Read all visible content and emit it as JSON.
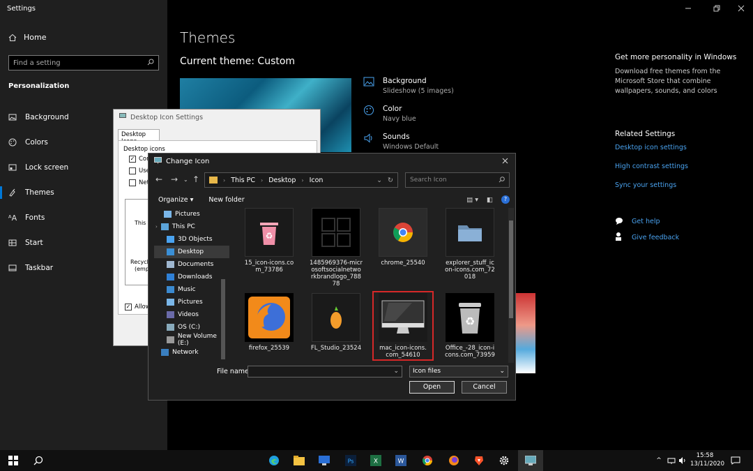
{
  "settings": {
    "window_title": "Settings",
    "home": "Home",
    "search_placeholder": "Find a setting",
    "section": "Personalization",
    "nav": [
      {
        "label": "Background",
        "icon": "picture-icon"
      },
      {
        "label": "Colors",
        "icon": "palette-icon"
      },
      {
        "label": "Lock screen",
        "icon": "lock-screen-icon"
      },
      {
        "label": "Themes",
        "icon": "themes-icon",
        "active": true
      },
      {
        "label": "Fonts",
        "icon": "fonts-icon"
      },
      {
        "label": "Start",
        "icon": "start-icon"
      },
      {
        "label": "Taskbar",
        "icon": "taskbar-icon"
      }
    ],
    "main_title": "Themes",
    "current_theme": "Current theme: Custom",
    "props": [
      {
        "title": "Background",
        "sub": "Slideshow (5 images)"
      },
      {
        "title": "Color",
        "sub": "Navy blue"
      },
      {
        "title": "Sounds",
        "sub": "Windows Default"
      }
    ],
    "right": {
      "personality_heading": "Get more personality in Windows",
      "personality_text": "Download free themes from the Microsoft Store that combine wallpapers, sounds, and colors",
      "related_heading": "Related Settings",
      "links": [
        "Desktop icon settings",
        "High contrast settings",
        "Sync your settings"
      ],
      "help": "Get help",
      "feedback": "Give feedback"
    }
  },
  "desktop_icon_settings": {
    "title": "Desktop Icon Settings",
    "tab": "Desktop Icons",
    "group": "Desktop icons",
    "checkboxes": [
      {
        "label": "Com",
        "checked": true
      },
      {
        "label": "User",
        "checked": false
      },
      {
        "label": "Netw",
        "checked": false
      }
    ],
    "icon_labels": [
      "This P",
      "Recycle",
      "(empt"
    ],
    "allow": "Allow t"
  },
  "change_icon": {
    "title": "Change Icon",
    "path": [
      "This PC",
      "Desktop",
      "Icon"
    ],
    "search_placeholder": "Search Icon",
    "organize": "Organize",
    "new_folder": "New folder",
    "tree": [
      {
        "label": "Pictures",
        "indent": 1
      },
      {
        "label": "This PC",
        "indent": 0
      },
      {
        "label": "3D Objects",
        "indent": 1
      },
      {
        "label": "Desktop",
        "indent": 1,
        "selected": true
      },
      {
        "label": "Documents",
        "indent": 1
      },
      {
        "label": "Downloads",
        "indent": 1
      },
      {
        "label": "Music",
        "indent": 1
      },
      {
        "label": "Pictures",
        "indent": 1
      },
      {
        "label": "Videos",
        "indent": 1
      },
      {
        "label": "OS (C:)",
        "indent": 1
      },
      {
        "label": "New Volume (E:)",
        "indent": 1
      },
      {
        "label": "Network",
        "indent": 0
      }
    ],
    "files": [
      {
        "name": "15_icon-icons.co m_73786",
        "kind": "recycle-pink-icon"
      },
      {
        "name": "1485969376-micr osoftsocialnetwo rkbrandlogo_788 78",
        "kind": "windows-logo-icon"
      },
      {
        "name": "chrome_25540",
        "kind": "chrome-icon"
      },
      {
        "name": "explorer_stuff_ic on-icons.com_72 018",
        "kind": "folder-icon"
      },
      {
        "name": "firefox_25539",
        "kind": "firefox-icon"
      },
      {
        "name": "FL_Studio_23524",
        "kind": "fl-studio-icon"
      },
      {
        "name": "mac_icon-icons. com_54610",
        "kind": "imac-icon",
        "selected": true
      },
      {
        "name": "Office_-28_icon-i cons.com_73959",
        "kind": "recycle-gray-icon"
      }
    ],
    "file_name_label": "File name:",
    "file_name_value": "",
    "file_type": "Icon files",
    "open": "Open",
    "cancel": "Cancel"
  },
  "taskbar": {
    "time": "15:58",
    "date": "13/11/2020"
  }
}
